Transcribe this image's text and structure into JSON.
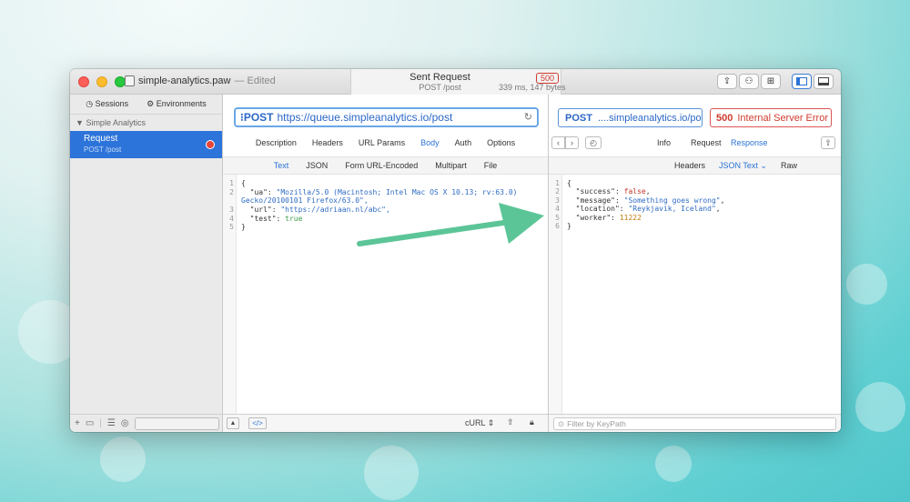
{
  "window": {
    "title": "simple-analytics.paw",
    "edited": "— Edited"
  },
  "status": {
    "title": "Sent Request",
    "subtitle": "POST /post",
    "code": "500",
    "meta": "339 ms, 147 bytes"
  },
  "sidebar": {
    "tabs": [
      {
        "label": "Sessions"
      },
      {
        "label": "Environments"
      }
    ],
    "group": "Simple Analytics",
    "items": [
      {
        "title": "Request",
        "subtitle": "POST /post"
      }
    ]
  },
  "request": {
    "method": "POST",
    "url": "https://queue.simpleanalytics.io/post",
    "tabs": [
      "Description",
      "Headers",
      "URL Params",
      "Body",
      "Auth",
      "Options"
    ],
    "active_tab": "Body",
    "body_tabs": [
      "Text",
      "JSON",
      "Form URL-Encoded",
      "Multipart",
      "File"
    ],
    "active_body_tab": "Text",
    "bottom": {
      "format": "cURL"
    },
    "code_lines": [
      {
        "n": "1",
        "text": "{"
      },
      {
        "n": "2",
        "key": "\"ua\": ",
        "value": "\"Mozilla/5.0 (Macintosh; Intel Mac OS X 10.13; rv:63.0)"
      },
      {
        "n": "",
        "cont": "Gecko/20100101 Firefox/63.0\","
      },
      {
        "n": "3",
        "key": "\"url\": ",
        "value": "\"https://adriaan.nl/abc\","
      },
      {
        "n": "4",
        "key": "\"test\": ",
        "value": "true"
      },
      {
        "n": "5",
        "text": "}"
      }
    ]
  },
  "response": {
    "method": "POST",
    "url": "....simpleanalytics.io/post",
    "status_code": "500",
    "status_text": "Internal Server Error",
    "tabs": [
      "Info",
      "Request",
      "Response"
    ],
    "active_tab": "Response",
    "view_tabs": [
      "Headers",
      "JSON Text",
      "Raw"
    ],
    "active_view": "JSON Text",
    "filter_placeholder": "Filter by KeyPath",
    "code_lines": [
      {
        "n": "1",
        "text": "{"
      },
      {
        "n": "2",
        "key": "\"success\": ",
        "value": "false",
        "tail": ","
      },
      {
        "n": "3",
        "key": "\"message\": ",
        "value": "\"Something goes wrong\"",
        "tail": ","
      },
      {
        "n": "4",
        "key": "\"location\": ",
        "value": "\"Reykjavik, Iceland\"",
        "tail": ","
      },
      {
        "n": "5",
        "key": "\"worker\": ",
        "value": "11222",
        "tail": ""
      },
      {
        "n": "6",
        "text": "}"
      }
    ]
  },
  "colors": {
    "accent": "#2b73d6",
    "selection": "#2d74da",
    "error": "#d03b2e",
    "annotation_arrow": "#5cc598"
  }
}
